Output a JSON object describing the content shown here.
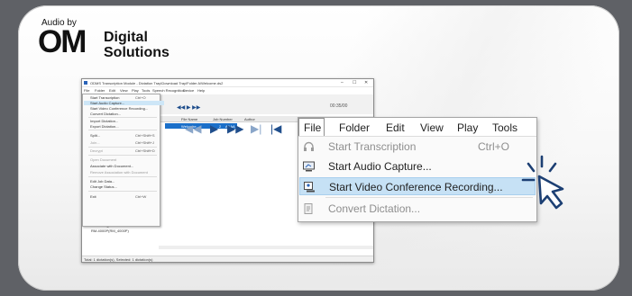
{
  "brand": {
    "audio_by": "Audio by",
    "om": "OM",
    "digital": "Digital",
    "solutions": "Solutions"
  },
  "small_window": {
    "title": "ODMS Transcription Module - Dictation Tray\\Download Tray\\Folder A\\Welcome.ds2",
    "controls": [
      "–",
      "☐",
      "✕"
    ],
    "menubar": [
      "File",
      "Folder",
      "Edit",
      "View",
      "Play",
      "Tools",
      "Speech Recognition",
      "Device",
      "Help"
    ],
    "file_menu": [
      {
        "label": "Start Transcription",
        "shortcut": "Ctrl+O"
      },
      {
        "label": "Start Audio Capture...",
        "shortcut": ""
      },
      {
        "label": "Start Video Conference Recording...",
        "shortcut": ""
      },
      {
        "label": "Convert Dictation...",
        "shortcut": ""
      },
      {
        "label": "Import Dictation...",
        "shortcut": ""
      },
      {
        "label": "Export Dictation...",
        "shortcut": ""
      },
      {
        "label": "Split...",
        "shortcut": "Ctrl+Shift+S"
      },
      {
        "label": "Join...",
        "shortcut": "Ctrl+Shift+J"
      },
      {
        "label": "Decrypt",
        "shortcut": "Ctrl+Shift+D"
      },
      {
        "label": "Open Document",
        "shortcut": ""
      },
      {
        "label": "Associate with Document...",
        "shortcut": ""
      },
      {
        "label": "Remove Association with Document",
        "shortcut": ""
      },
      {
        "label": "Edit Job Data...",
        "shortcut": ""
      },
      {
        "label": "Change Status...",
        "shortcut": ""
      },
      {
        "label": "Exit",
        "shortcut": "Ctrl+W"
      }
    ],
    "list_headers": [
      "File Name",
      "Job Number",
      "Author"
    ],
    "list_row": {
      "name": "Welcome...",
      "job": "2",
      "author": "AAAA"
    },
    "toolbar_time": "00:35/00",
    "tree": {
      "device_manager": "Device Manager",
      "device": "RM-4000P(RM_4000P)"
    },
    "status": "Total: 1 dictation(s), Selected: 1 dictation(s)"
  },
  "big_menu": {
    "menubar": [
      "File",
      "Folder",
      "Edit",
      "View",
      "Play",
      "Tools"
    ],
    "items": [
      {
        "label": "Start Transcription",
        "shortcut": "Ctrl+O",
        "icon": "headphones-icon",
        "state": "disabled"
      },
      {
        "label": "Start Audio Capture...",
        "shortcut": "",
        "icon": "audio-capture-icon",
        "state": "normal"
      },
      {
        "label": "Start Video Conference Recording...",
        "shortcut": "",
        "icon": "video-conference-icon",
        "state": "highlighted"
      },
      {
        "label": "Convert Dictation...",
        "shortcut": "",
        "icon": "convert-icon",
        "state": "disabled"
      }
    ]
  },
  "colors": {
    "highlight": "#c6e1f5",
    "selection": "#1b6fc9",
    "toolbar_blue": "#1f4e8c"
  }
}
